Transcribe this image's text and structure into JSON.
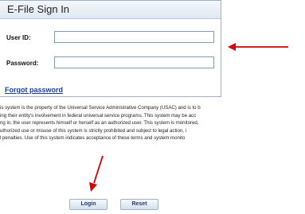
{
  "panel": {
    "title": "E-File Sign In",
    "user_id_label": "User ID:",
    "user_id_value": "",
    "password_label": "Password:",
    "password_value": "",
    "forgot_label": "Forgot password"
  },
  "disclaimer_lines": [
    "is system is the property of the Universal Service Administrative Company (USAC) and is to b",
    "ing their entity's involvement in federal universal service programs. This system may be acc",
    "ng in, the user represents himself or herself as an authorized user. This system is monitored,",
    "uthorized use or misuse of this system is strictly prohibited and subject to legal action, i",
    "l penalties. Use of this system indicates acceptance of these terms and system monito"
  ],
  "buttons": {
    "login_label": "Login",
    "reset_label": "Reset"
  },
  "colors": {
    "annotation_arrow": "#d80000",
    "link": "#1a3f9c",
    "panel_border": "#9bb3cc"
  }
}
